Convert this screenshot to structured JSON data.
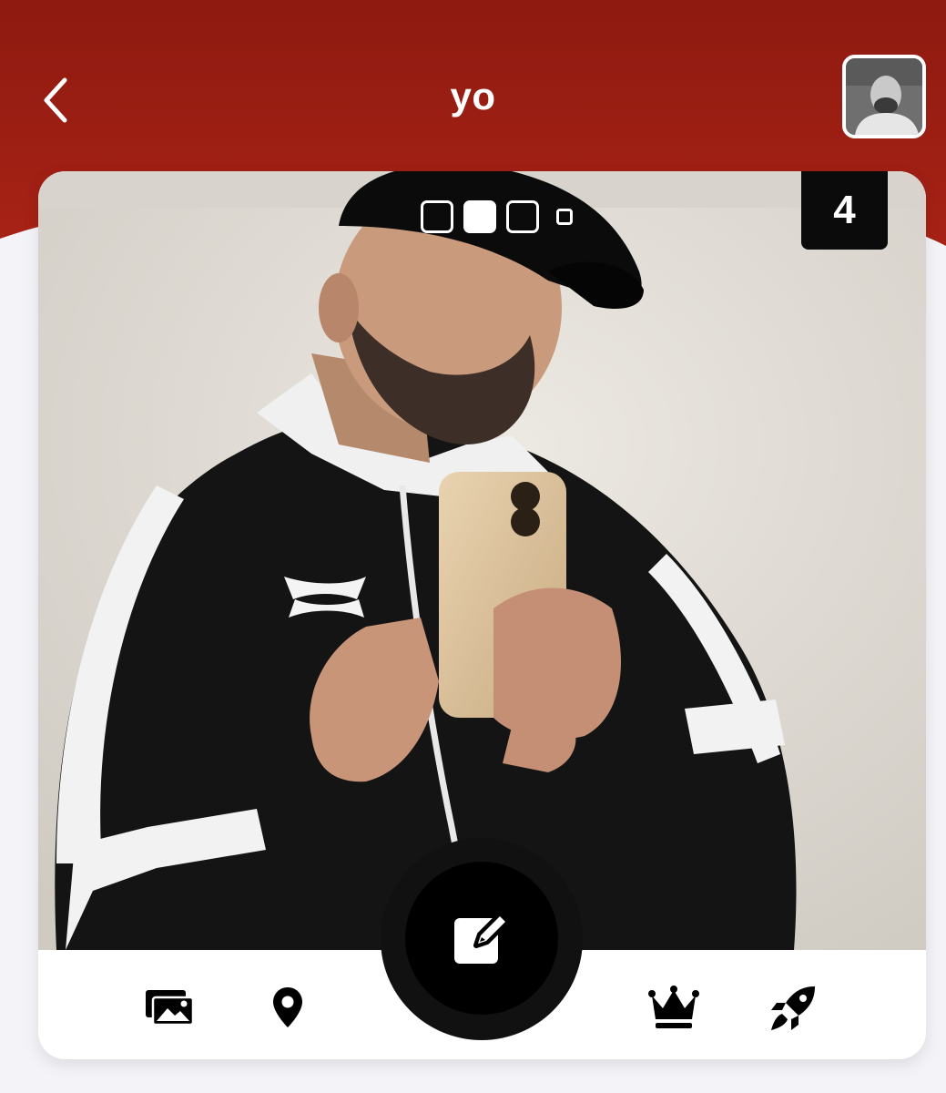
{
  "header": {
    "title": "yo",
    "background_color": "#9a1b12",
    "back_icon": "chevron-left-icon",
    "avatar_description": "profile-thumbnail"
  },
  "photo_card": {
    "photo_count": "4",
    "pager": {
      "total_dots": 4,
      "active_index": 1
    }
  },
  "toolbar": {
    "items": [
      {
        "icon": "gallery-icon"
      },
      {
        "icon": "location-pin-icon"
      },
      {
        "icon": "crown-icon"
      },
      {
        "icon": "rocket-icon"
      }
    ],
    "fab_icon": "edit-icon"
  }
}
